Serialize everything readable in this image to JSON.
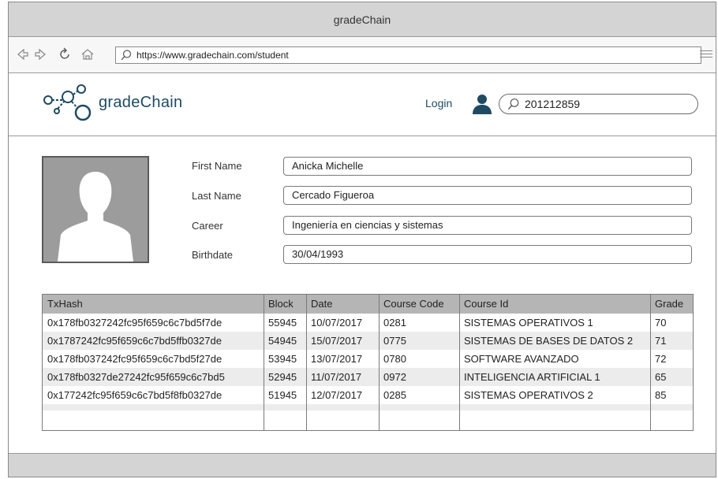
{
  "window": {
    "title": "gradeChain"
  },
  "browser": {
    "url": "https://www.gradechain.com/student",
    "back_icon": "back-arrow-icon",
    "forward_icon": "forward-arrow-icon",
    "refresh_icon": "refresh-icon",
    "home_icon": "home-icon"
  },
  "header": {
    "brand": "gradeChain",
    "login_label": "Login",
    "search_value": "201212859",
    "brand_color": "#1e4a63"
  },
  "profile": {
    "labels": {
      "first_name": "First Name",
      "last_name": "Last Name",
      "career": "Career",
      "birthdate": "Birthdate"
    },
    "values": {
      "first_name": "Anicka Michelle",
      "last_name": "Cercado Figueroa",
      "career": "Ingeniería en ciencias y sistemas",
      "birthdate": "30/04/1993"
    }
  },
  "table": {
    "headers": [
      "TxHash",
      "Block",
      "Date",
      "Course Code",
      "Course Id",
      "Grade"
    ],
    "rows": [
      [
        "0x178fb0327242fc95f659c6c7bd5f7de",
        "55945",
        "10/07/2017",
        "0281",
        "SISTEMAS OPERATIVOS 1",
        "70"
      ],
      [
        "0x1787242fc95f659c6c7bd5ffb0327de",
        "54945",
        "15/07/2017",
        "0775",
        "SISTEMAS DE BASES DE DATOS 2",
        "71"
      ],
      [
        "0x178fb037242fc95f659c6c7bd5f27de",
        "53945",
        "13/07/2017",
        "0780",
        "SOFTWARE AVANZADO",
        "72"
      ],
      [
        "0x178fb0327de27242fc95f659c6c7bd5",
        "52945",
        "11/07/2017",
        "0972",
        "INTELIGENCIA ARTIFICIAL 1",
        "65"
      ],
      [
        "0x177242fc95f659c6c7bd5f8fb0327de",
        "51945",
        "12/07/2017",
        "0285",
        "SISTEMAS OPERATIVOS 2",
        "85"
      ]
    ]
  }
}
